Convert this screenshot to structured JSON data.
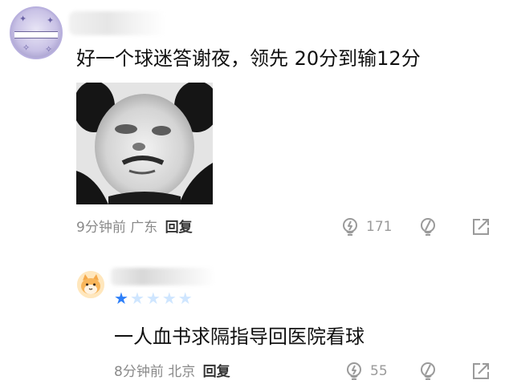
{
  "comments": [
    {
      "text": "好一个球迷答谢夜，领先 20分到输12分",
      "time": "9分钟前",
      "location": "广东",
      "reply_label": "回复",
      "like_count": "171"
    },
    {
      "text": "一人血书求隔指导回医院看球",
      "time": "8分钟前",
      "location": "北京",
      "reply_label": "回复",
      "like_count": "55",
      "rating": {
        "filled": 1,
        "total": 5
      }
    }
  ],
  "colors": {
    "text": "#111111",
    "meta": "#8a8a8a",
    "icon": "#9a9a9a",
    "star_filled": "#2d7ff9",
    "star_empty": "#cfe6ff"
  },
  "icons": {
    "like": "lightbulb-icon",
    "dislike": "lightbulb-slash-icon",
    "share": "share-arrow-icon"
  }
}
